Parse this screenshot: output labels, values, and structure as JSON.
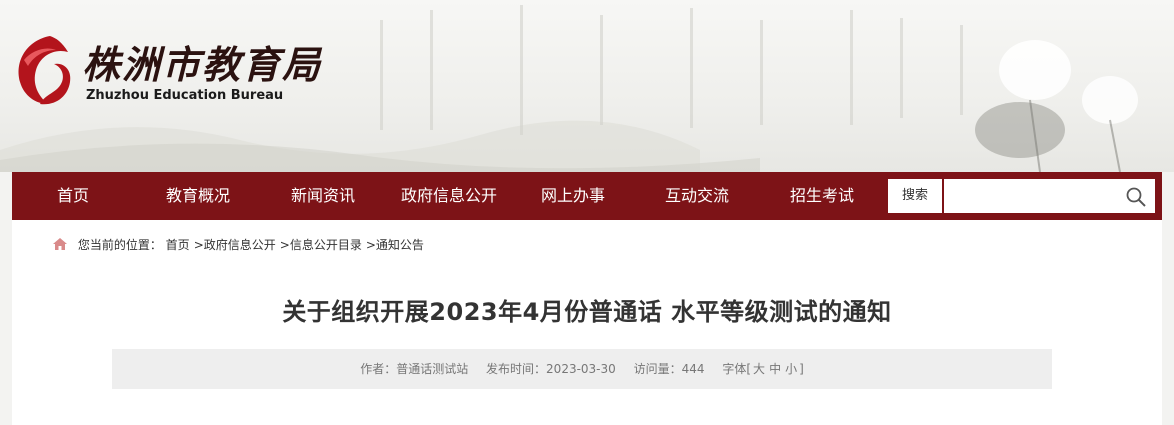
{
  "logo": {
    "cn": "株洲市教育局",
    "en": "Zhuzhou Education Bureau"
  },
  "nav": {
    "items": [
      {
        "label": "首页"
      },
      {
        "label": "教育概况"
      },
      {
        "label": "新闻资讯"
      },
      {
        "label": "政府信息公开"
      },
      {
        "label": "网上办事"
      },
      {
        "label": "互动交流"
      },
      {
        "label": "招生考试"
      }
    ],
    "search_label": "搜索",
    "search_placeholder": ""
  },
  "breadcrumb": {
    "prefix": "您当前的位置：",
    "items": [
      "首页",
      "政府信息公开",
      "信息公开目录",
      "通知公告"
    ],
    "separator": ">"
  },
  "article": {
    "title": "关于组织开展2023年4月份普通话 水平等级测试的通知",
    "author": "作者：普通话测试站",
    "published": "发布时间：2023-03-30",
    "views": "访问量：444",
    "font_label": "字体[",
    "font_large": "大",
    "font_medium": "中",
    "font_small": "小",
    "font_end": "]"
  },
  "colors": {
    "nav_bg": "#7d1317",
    "logo_red": "#b3141c"
  },
  "icons": [
    "home-icon",
    "search-icon",
    "logo-emblem-icon"
  ]
}
